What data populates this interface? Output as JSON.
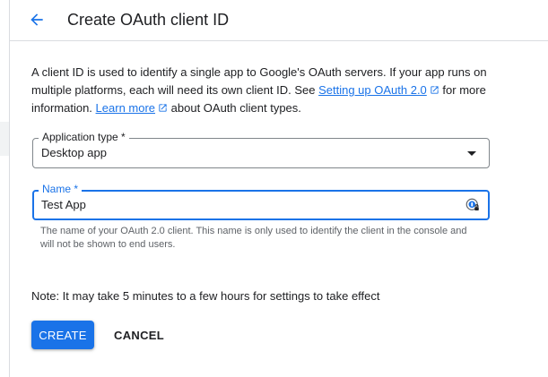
{
  "header": {
    "title": "Create OAuth client ID",
    "back_icon": "arrow-back-icon"
  },
  "intro": {
    "text_1": "A client ID is used to identify a single app to Google's OAuth servers. If your app runs on multiple platforms, each will need its own client ID. See ",
    "link_setup": "Setting up OAuth 2.0",
    "text_2": " for more information. ",
    "link_learn": "Learn more",
    "text_3": " about OAuth client types."
  },
  "application_type": {
    "label": "Application type *",
    "value": "Desktop app"
  },
  "name_field": {
    "label": "Name *",
    "value": "Test App",
    "helper": "The name of your OAuth 2.0 client. This name is only used to identify the client in the console and will not be shown to end users."
  },
  "note": "Note: It may take 5 minutes to a few hours for settings to take effect",
  "actions": {
    "create_label": "CREATE",
    "cancel_label": "CANCEL"
  },
  "colors": {
    "accent": "#1a73e8",
    "text": "#202124",
    "muted": "#5f6368",
    "border": "#dadce0"
  }
}
